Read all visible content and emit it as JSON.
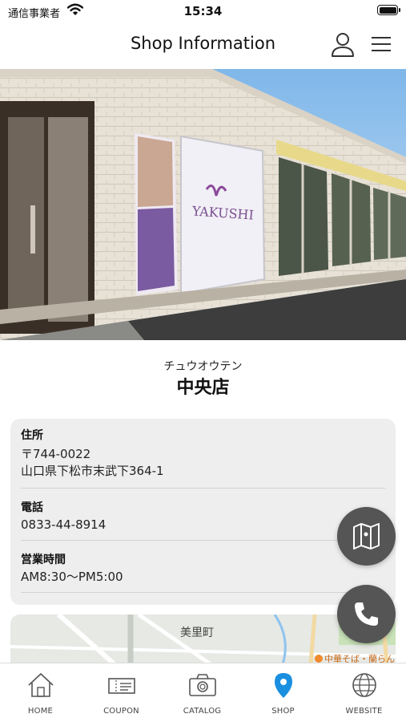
{
  "status_bar": {
    "carrier": "通信事業者",
    "time": "15:34"
  },
  "nav": {
    "title": "Shop Information"
  },
  "shop": {
    "name_kana": "チュウオウテン",
    "name": "中央店",
    "sign_text": "YAKUSHI"
  },
  "info": {
    "address_label": "住所",
    "postal_code": "〒744-0022",
    "address": "山口県下松市末武下364-1",
    "phone_label": "電話",
    "phone": "0833-44-8914",
    "hours_label": "営業時間",
    "hours": "AM8:30〜PM5:00"
  },
  "map": {
    "town_label": "美里町",
    "poi_label": "中華そば・蘭らん"
  },
  "tabs": [
    {
      "label": "HOME",
      "icon": "home-icon"
    },
    {
      "label": "COUPON",
      "icon": "coupon-icon"
    },
    {
      "label": "CATALOG",
      "icon": "camera-icon"
    },
    {
      "label": "SHOP",
      "icon": "location-pin-icon",
      "active": true
    },
    {
      "label": "WEBSITE",
      "icon": "globe-icon"
    }
  ],
  "colors": {
    "accent": "#1a8fe0",
    "fab": "#555555",
    "card_bg": "#eeeeee"
  }
}
